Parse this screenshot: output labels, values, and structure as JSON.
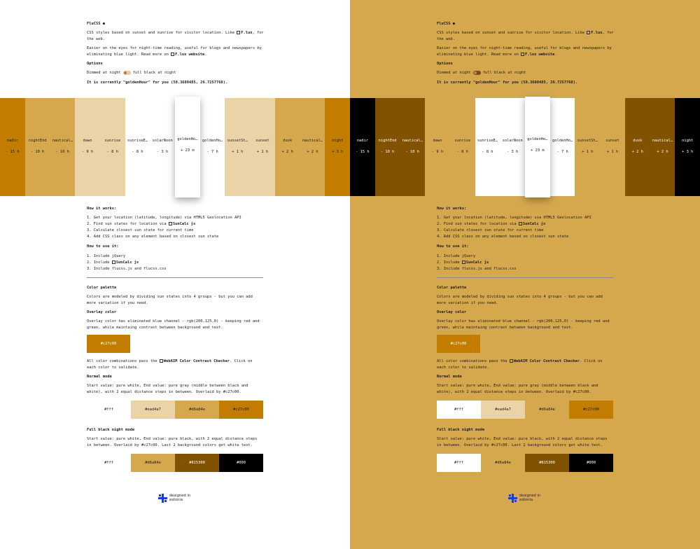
{
  "app": {
    "title": "FluCSS",
    "intro": "CSS styles based on sunset and sunrise for visitor location. Like",
    "intro_link": "F.lux",
    "intro_tail": ", for the web.",
    "easier_text": "Easier on the eyes for night-time reading, useful for blogs and newspapers by eliminating blue light. Read more on",
    "easier_link": "F.lux website",
    "easier_tail": ".",
    "options_heading": "Options",
    "option_left": "Dimmed at night",
    "option_right": "full black at night",
    "current_status": "It is currently \"goldenHour\" for you (58.3680485, 26.7257768)."
  },
  "sun_states": [
    {
      "name": "nadir",
      "time": "- 15 h"
    },
    {
      "name": "nightEnd",
      "time": "- 10 h"
    },
    {
      "name": "nautical…",
      "time": "- 10 h"
    },
    {
      "name": "dawn",
      "time": "- 9 h"
    },
    {
      "name": "sunrise",
      "time": "- 8 h"
    },
    {
      "name": "sunriseE…",
      "time": "- 8 h"
    },
    {
      "name": "solarNoon",
      "time": "- 3 h"
    },
    {
      "name": "goldenHo…",
      "time": "+ 23 m"
    },
    {
      "name": "goldenHo…",
      "time": "- 7 h"
    },
    {
      "name": "sunsetSt…",
      "time": "+ 1 h"
    },
    {
      "name": "sunset",
      "time": "+ 1 h"
    },
    {
      "name": "dusk",
      "time": "+ 2 h"
    },
    {
      "name": "nautical…",
      "time": "+ 2 h"
    },
    {
      "name": "night",
      "time": "+ 3 h"
    }
  ],
  "strip_colors": {
    "normal": [
      "#c27c00",
      "#d6a84e",
      "#d6a84e",
      "#ead4a7",
      "#ead4a7",
      "#ffffff",
      "#ffffff",
      "#ffffff",
      "#ffffff",
      "#ead4a7",
      "#ead4a7",
      "#d6a84e",
      "#d6a84e",
      "#c27c00"
    ],
    "normal_text": [
      "#1a1a1a",
      "#1a1a1a",
      "#1a1a1a",
      "#1a1a1a",
      "#1a1a1a",
      "#1a1a1a",
      "#1a1a1a",
      "#1a1a1a",
      "#1a1a1a",
      "#1a1a1a",
      "#1a1a1a",
      "#1a1a1a",
      "#1a1a1a",
      "#1a1a1a"
    ],
    "black": [
      "#000000",
      "#815300",
      "#815300",
      "#d6a84e",
      "#d6a84e",
      "#ffffff",
      "#ffffff",
      "#ffffff",
      "#ffffff",
      "#d6a84e",
      "#d6a84e",
      "#815300",
      "#815300",
      "#000000"
    ],
    "black_text": [
      "#ffffff",
      "#ffffff",
      "#ffffff",
      "#1a1a1a",
      "#1a1a1a",
      "#1a1a1a",
      "#1a1a1a",
      "#1a1a1a",
      "#1a1a1a",
      "#1a1a1a",
      "#1a1a1a",
      "#ffffff",
      "#ffffff",
      "#ffffff"
    ]
  },
  "how_it_works": {
    "heading": "How it works:",
    "steps": [
      "1. Get your location (latitude, longitude) via HTML5 Geolocation API",
      "2. Find sun states for location via",
      "3. Calculate closest sun state for current time",
      "4. Add CSS class on any element based on closest sun state"
    ],
    "suncalc_link": "SunCalc js"
  },
  "how_to_use": {
    "heading": "How to use it:",
    "steps": [
      "1. Include jQuery",
      "2. Include",
      "3. Include flucss.js and flucss.css"
    ],
    "suncalc_link": "SunCalc js"
  },
  "palette": {
    "heading": "Color palette",
    "intro": "Colors are modeled by dividing sun states into 4 groups - but you can add more variation if you need.",
    "overlay_heading": "Overlay color",
    "overlay_text": "Overlay color has eliminated blue channel - rgb(200,125,0) - keeping red and green, while maintaing contrast between background and text.",
    "overlay_value": "#c27c00",
    "contrast_text_a": "All color combinations pass the",
    "contrast_link": "WebAIM Color Contrast Checker",
    "contrast_text_b": ". Click on each color to validate.",
    "normal_heading": "Normal mode",
    "normal_text": "Start value: pure white, End value: pure gray (middle between black and white), with 2 equal distance steps in between. Overlaid by #c27c00.",
    "normal_swatches": [
      {
        "label": "#fff",
        "color": "#ffffff",
        "text": "#1a1a1a"
      },
      {
        "label": "#ead4a7",
        "color": "#ead4a7",
        "text": "#1a1a1a"
      },
      {
        "label": "#d6a84e",
        "color": "#d6a84e",
        "text": "#1a1a1a"
      },
      {
        "label": "#c27c00",
        "color": "#c27c00",
        "text": "#1a1a1a"
      }
    ],
    "black_heading": "Full black night mode",
    "black_text": "Start value: pure white, End value: pure black, with 2 equal distance steps in between. Overlaid by #c27c00. Last 2 background colors get white text.",
    "black_swatches": [
      {
        "label": "#fff",
        "color": "#ffffff",
        "text": "#1a1a1a"
      },
      {
        "label": "#d6a84e",
        "color": "#d6a84e",
        "text": "#1a1a1a"
      },
      {
        "label": "#815300",
        "color": "#815300",
        "text": "#ffffff"
      },
      {
        "label": "#000",
        "color": "#000000",
        "text": "#ffffff"
      }
    ]
  },
  "footer": {
    "line1": "designed in",
    "line2": "estonia"
  }
}
